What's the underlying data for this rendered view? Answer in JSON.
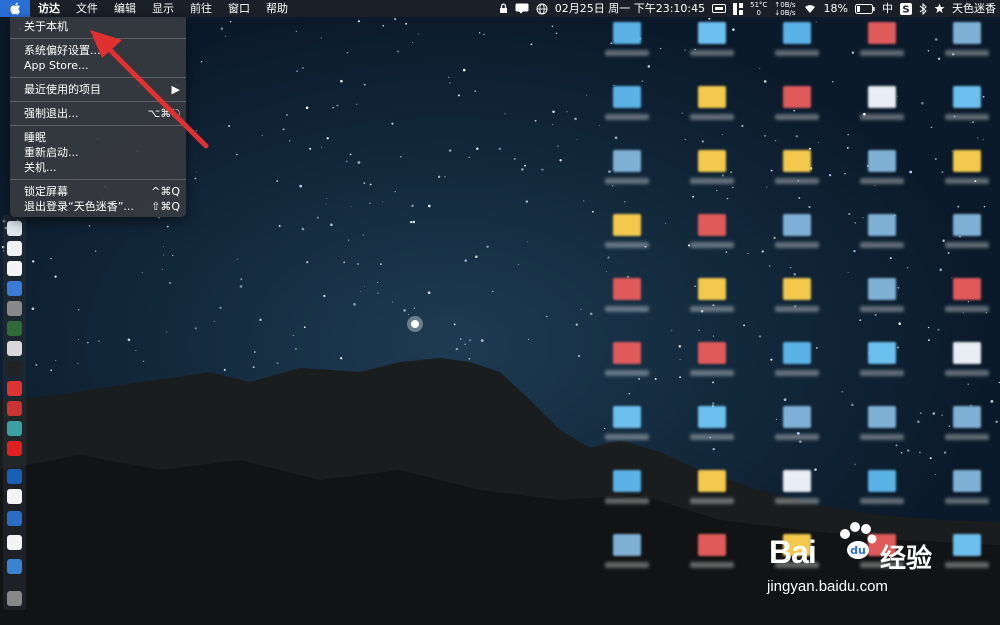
{
  "menubar": {
    "app_name": "访达",
    "menus": [
      "文件",
      "编辑",
      "显示",
      "前往",
      "窗口",
      "帮助"
    ],
    "status": {
      "datetime": "02月25日 周一 下午23:10:45",
      "temp_top": "51°C",
      "temp_bottom": "0",
      "net_up": "↑0B/s",
      "net_down": "↓0B/s",
      "battery": "18%",
      "input_method": "中",
      "user_name": "天色迷香"
    }
  },
  "apple_menu": {
    "items": [
      {
        "label": "关于本机",
        "shortcut": ""
      },
      {
        "label": "系统偏好设置...",
        "shortcut": ""
      },
      {
        "label": "App Store...",
        "shortcut": ""
      },
      {
        "label": "最近使用的项目",
        "shortcut": "▶"
      },
      {
        "label": "强制退出...",
        "shortcut": "⌥⌘⎋"
      },
      {
        "label": "睡眠",
        "shortcut": ""
      },
      {
        "label": "重新启动...",
        "shortcut": ""
      },
      {
        "label": "关机...",
        "shortcut": ""
      },
      {
        "label": "锁定屏幕",
        "shortcut": "^⌘Q"
      },
      {
        "label": "退出登录“天色迷香”...",
        "shortcut": "⇧⌘Q"
      }
    ]
  },
  "watermark": {
    "brand": "Bai",
    "suffix": "经验",
    "url": "jingyan.baidu.com"
  },
  "colors": {
    "menu_highlight": "#2a6fd6",
    "arrow": "#e03030"
  }
}
